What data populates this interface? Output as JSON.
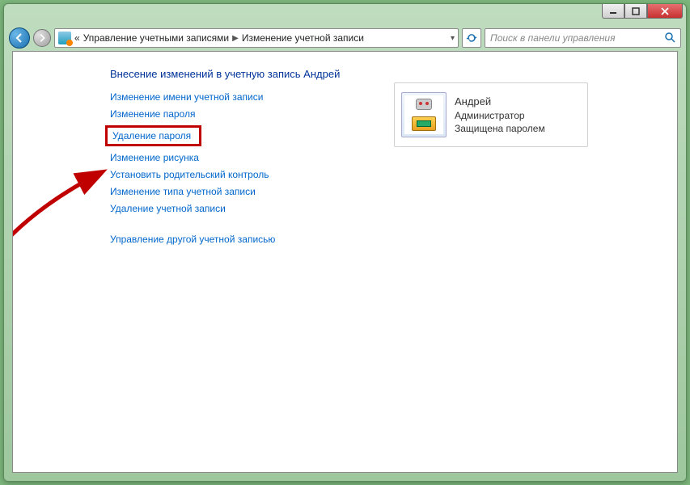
{
  "breadcrumb": {
    "seg1": "Управление учетными записями",
    "seg2": "Изменение учетной записи"
  },
  "search": {
    "placeholder": "Поиск в панели управления"
  },
  "page": {
    "title": "Внесение изменений в учетную запись Андрей"
  },
  "links": {
    "rename": "Изменение имени учетной записи",
    "change_pw": "Изменение пароля",
    "delete_pw": "Удаление пароля",
    "change_pic": "Изменение рисунка",
    "parental": "Установить родительский контроль",
    "change_type": "Изменение типа учетной записи",
    "delete_acc": "Удаление учетной записи",
    "manage_other": "Управление другой учетной записью"
  },
  "account": {
    "name": "Андрей",
    "role": "Администратор",
    "status": "Защищена паролем"
  }
}
